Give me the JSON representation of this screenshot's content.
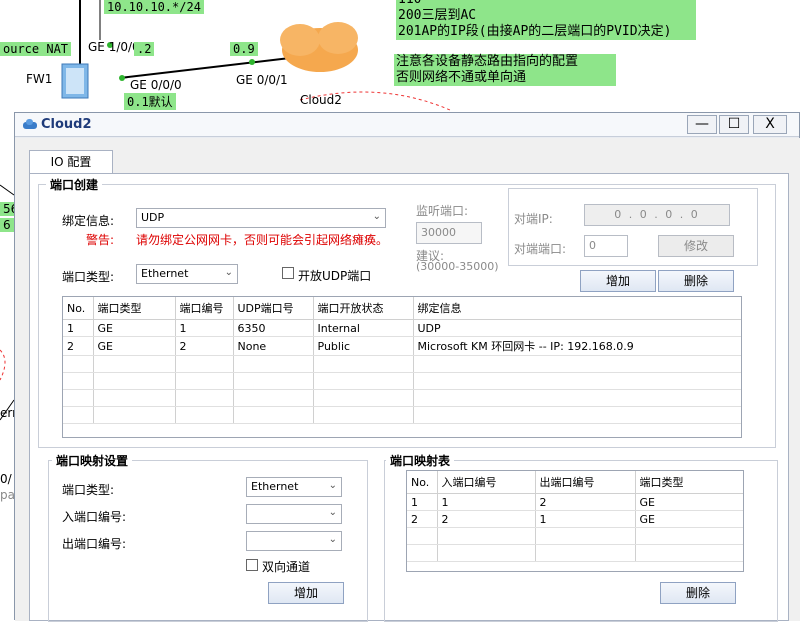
{
  "background": {
    "subnet_label": "10.10.10.*/24",
    "nat_label": "ource NAT",
    "fw1_port": "GE 1/0/0",
    "fw1_port_ip": ".2",
    "fw1_name": "FW1",
    "fw1_port2": "GE 0/0/0",
    "fw1_port2_ip": "0.1默认",
    "cloud_port_ip": "0.9",
    "cloud_port": "GE 0/0/1",
    "cloud_name": "Cloud2",
    "note_lines_top": [
      "110",
      "200三层到AC",
      "201AP的IP段(由接AP的二层端口的PVID决定)"
    ],
    "note_lines_bottom": [
      "注意各设备静态路由指向的配置",
      "否则网络不通或单向通"
    ],
    "left_edge_labels": [
      "56",
      "6",
      "ern",
      "0/",
      "pa"
    ]
  },
  "dialog": {
    "title": "Cloud2",
    "min_label": "—",
    "max_label": "☐",
    "close_label": "X",
    "tab_label": "IO 配置",
    "port_create": {
      "title": "端口创建",
      "bind_label": "绑定信息:",
      "bind_value": "UDP",
      "warning_label": "警告:",
      "warning_text": "请勿绑定公网网卡，否则可能会引起网络瘫痪。",
      "port_type_label": "端口类型:",
      "port_type_value": "Ethernet",
      "open_udp_label": "开放UDP端口",
      "listen_port_label": "监听端口:",
      "listen_port_value": "30000",
      "suggest_label": "建议:",
      "suggest_range": "(30000-35000)",
      "peer_ip_label": "对端IP:",
      "peer_ip_value": "0 . 0 . 0 . 0",
      "peer_port_label": "对端端口:",
      "peer_port_value": "0",
      "modify_label": "修改",
      "add_label": "增加",
      "delete_label": "删除",
      "table": {
        "headers": [
          "No.",
          "端口类型",
          "端口编号",
          "UDP端口号",
          "端口开放状态",
          "绑定信息"
        ],
        "rows": [
          [
            "1",
            "GE",
            "1",
            "6350",
            "Internal",
            "UDP"
          ],
          [
            "2",
            "GE",
            "2",
            "None",
            "Public",
            "Microsoft KM 环回网卡 -- IP: 192.168.0.9"
          ]
        ]
      }
    },
    "port_map_settings": {
      "title": "端口映射设置",
      "port_type_label": "端口类型:",
      "port_type_value": "Ethernet",
      "in_port_label": "入端口编号:",
      "out_port_label": "出端口编号:",
      "bidirectional_label": "双向通道",
      "add_label": "增加"
    },
    "port_map_table": {
      "title": "端口映射表",
      "headers": [
        "No.",
        "入端口编号",
        "出端口编号",
        "端口类型"
      ],
      "rows": [
        [
          "1",
          "1",
          "2",
          "GE"
        ],
        [
          "2",
          "2",
          "1",
          "GE"
        ]
      ],
      "delete_label": "删除"
    }
  }
}
